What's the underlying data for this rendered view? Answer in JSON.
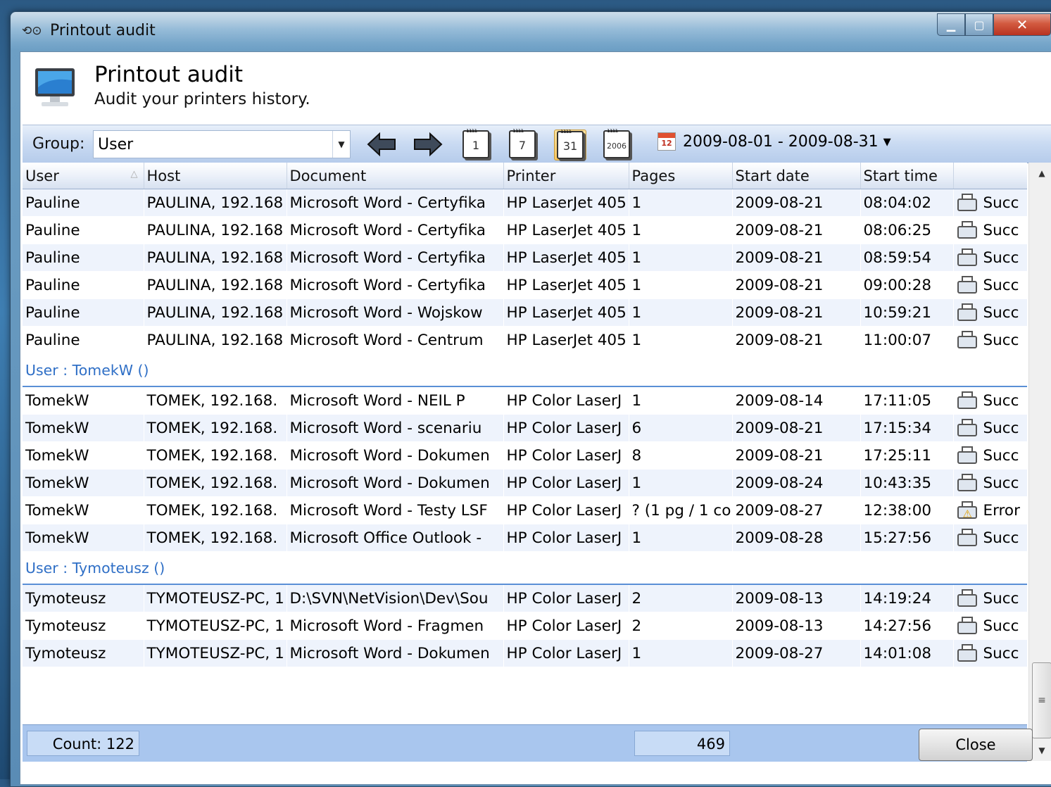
{
  "window": {
    "title": "Printout audit"
  },
  "header": {
    "title": "Printout audit",
    "subtitle": "Audit your printers history."
  },
  "toolbar": {
    "group_label": "Group:",
    "group_value": "User",
    "cal_day": "1",
    "cal_week": "7",
    "cal_month": "31",
    "cal_year": "2006",
    "date_icon_text": "12",
    "date_range": "2009-08-01 - 2009-08-31 ▾"
  },
  "columns": [
    "User",
    "Host",
    "Document",
    "Printer",
    "Pages",
    "Start date",
    "Start time",
    ""
  ],
  "groups": [
    {
      "header": "",
      "rows": [
        [
          "Pauline",
          "PAULINA, 192.168",
          "Microsoft Word - Certyfika",
          "HP LaserJet 405",
          "1",
          "2009-08-21",
          "08:04:02",
          "Succ"
        ],
        [
          "Pauline",
          "PAULINA, 192.168",
          "Microsoft Word - Certyfika",
          "HP LaserJet 405",
          "1",
          "2009-08-21",
          "08:06:25",
          "Succ"
        ],
        [
          "Pauline",
          "PAULINA, 192.168",
          "Microsoft Word - Certyfika",
          "HP LaserJet 405",
          "1",
          "2009-08-21",
          "08:59:54",
          "Succ"
        ],
        [
          "Pauline",
          "PAULINA, 192.168",
          "Microsoft Word - Certyfika",
          "HP LaserJet 405",
          "1",
          "2009-08-21",
          "09:00:28",
          "Succ"
        ],
        [
          "Pauline",
          "PAULINA, 192.168",
          "Microsoft Word - Wojskow",
          "HP LaserJet 405",
          "1",
          "2009-08-21",
          "10:59:21",
          "Succ"
        ],
        [
          "Pauline",
          "PAULINA, 192.168",
          "Microsoft Word - Centrum",
          "HP LaserJet 405",
          "1",
          "2009-08-21",
          "11:00:07",
          "Succ"
        ]
      ]
    },
    {
      "header": "User : TomekW ()",
      "rows": [
        [
          "TomekW",
          "TOMEK, 192.168.",
          "Microsoft Word - NEIL P",
          "HP Color LaserJ",
          "1",
          "2009-08-14",
          "17:11:05",
          "Succ"
        ],
        [
          "TomekW",
          "TOMEK, 192.168.",
          "Microsoft Word - scenariu",
          "HP Color LaserJ",
          "6",
          "2009-08-21",
          "17:15:34",
          "Succ"
        ],
        [
          "TomekW",
          "TOMEK, 192.168.",
          "Microsoft Word - Dokumen",
          "HP Color LaserJ",
          "8",
          "2009-08-21",
          "17:25:11",
          "Succ"
        ],
        [
          "TomekW",
          "TOMEK, 192.168.",
          "Microsoft Word - Dokumen",
          "HP Color LaserJ",
          "1",
          "2009-08-24",
          "10:43:35",
          "Succ"
        ],
        [
          "TomekW",
          "TOMEK, 192.168.",
          "Microsoft Word - Testy LSF",
          "HP Color LaserJ",
          "? (1 pg / 1 co",
          "2009-08-27",
          "12:38:00",
          "Error"
        ],
        [
          "TomekW",
          "TOMEK, 192.168.",
          "Microsoft Office Outlook -",
          "HP Color LaserJ",
          "1",
          "2009-08-28",
          "15:27:56",
          "Succ"
        ]
      ]
    },
    {
      "header": "User : Tymoteusz ()",
      "rows": [
        [
          "Tymoteusz",
          "TYMOTEUSZ-PC, 1",
          "D:\\SVN\\NetVision\\Dev\\Sou",
          "HP Color LaserJ",
          "2",
          "2009-08-13",
          "14:19:24",
          "Succ"
        ],
        [
          "Tymoteusz",
          "TYMOTEUSZ-PC, 1",
          "Microsoft Word - Fragmen",
          "HP Color LaserJ",
          "2",
          "2009-08-13",
          "14:27:56",
          "Succ"
        ],
        [
          "Tymoteusz",
          "TYMOTEUSZ-PC, 1",
          "Microsoft Word - Dokumen",
          "HP Color LaserJ",
          "1",
          "2009-08-27",
          "14:01:08",
          "Succ"
        ]
      ]
    }
  ],
  "summary": {
    "count": "Count: 122",
    "pages": "469"
  },
  "footer": {
    "close_label": "Close"
  },
  "colors": {
    "group_header": "#2f6fc6",
    "summary_bg": "#a9c6ee",
    "toolbar_bg": "#c9daf2"
  }
}
